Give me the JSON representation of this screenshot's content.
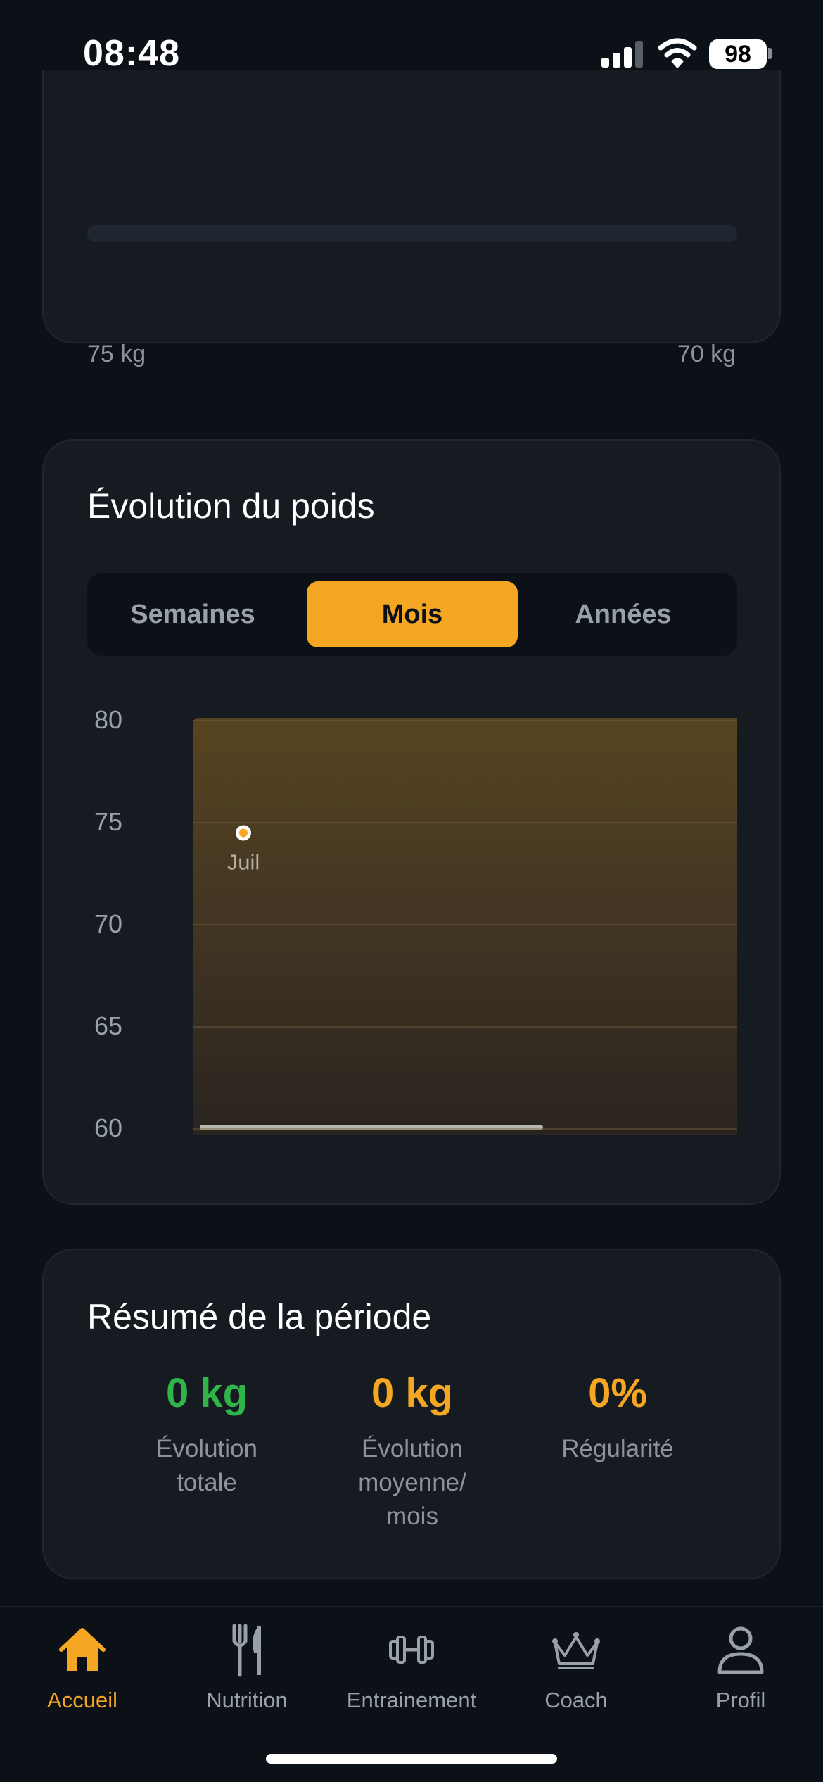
{
  "status_bar": {
    "time": "08:48",
    "battery": "98"
  },
  "goal_card": {
    "start_weight": "75 kg",
    "target_weight": "70 kg"
  },
  "chart_card": {
    "title": "Évolution du poids",
    "segments": [
      "Semaines",
      "Mois",
      "Années"
    ],
    "active_segment": "Mois"
  },
  "chart_data": {
    "type": "scatter",
    "x": [
      "Juil"
    ],
    "y": [
      74.5
    ],
    "ylim": [
      60,
      80
    ],
    "y_ticks": [
      "80",
      "75",
      "70",
      "65",
      "60"
    ],
    "grid": true,
    "point_color": "#f5a623"
  },
  "summary_card": {
    "title": "Résumé de la période",
    "stats": [
      {
        "value": "0 kg",
        "label_lines": [
          "Évolution",
          "totale"
        ],
        "color": "#2fb54a"
      },
      {
        "value": "0 kg",
        "label_lines": [
          "Évolution",
          "moyenne/",
          "mois"
        ],
        "color": "#f5a623"
      },
      {
        "value": "0%",
        "label_lines": [
          "Régularité"
        ],
        "color": "#f5a623"
      }
    ]
  },
  "tab_bar": {
    "tabs": [
      {
        "label": "Accueil",
        "icon": "home-icon",
        "active": true
      },
      {
        "label": "Nutrition",
        "icon": "fork-knife-icon",
        "active": false
      },
      {
        "label": "Entrainement",
        "icon": "dumbbell-icon",
        "active": false
      },
      {
        "label": "Coach",
        "icon": "crown-icon",
        "active": false
      },
      {
        "label": "Profil",
        "icon": "person-icon",
        "active": false
      }
    ]
  },
  "colors": {
    "accent": "#f5a623",
    "positive": "#2fb54a",
    "background": "#0c1017",
    "card": "#161b22"
  }
}
